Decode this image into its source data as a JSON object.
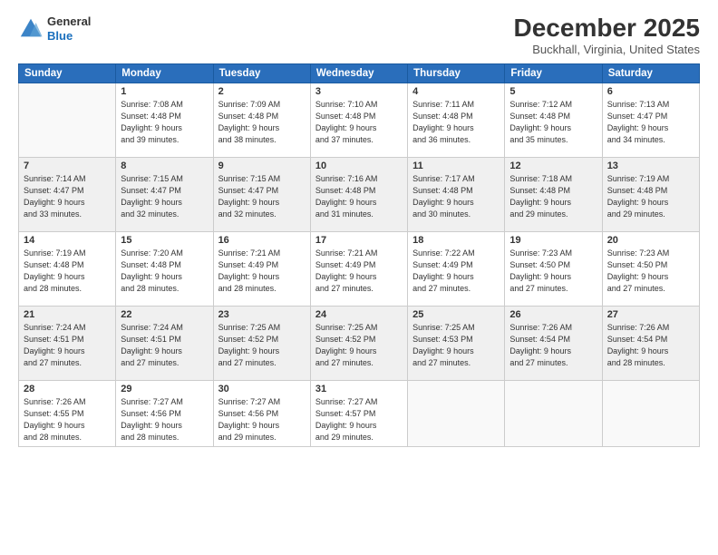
{
  "header": {
    "logo": {
      "general": "General",
      "blue": "Blue"
    },
    "title": "December 2025",
    "location": "Buckhall, Virginia, United States"
  },
  "calendar": {
    "days_of_week": [
      "Sunday",
      "Monday",
      "Tuesday",
      "Wednesday",
      "Thursday",
      "Friday",
      "Saturday"
    ],
    "weeks": [
      {
        "shaded": false,
        "days": [
          {
            "num": "",
            "info": ""
          },
          {
            "num": "1",
            "info": "Sunrise: 7:08 AM\nSunset: 4:48 PM\nDaylight: 9 hours\nand 39 minutes."
          },
          {
            "num": "2",
            "info": "Sunrise: 7:09 AM\nSunset: 4:48 PM\nDaylight: 9 hours\nand 38 minutes."
          },
          {
            "num": "3",
            "info": "Sunrise: 7:10 AM\nSunset: 4:48 PM\nDaylight: 9 hours\nand 37 minutes."
          },
          {
            "num": "4",
            "info": "Sunrise: 7:11 AM\nSunset: 4:48 PM\nDaylight: 9 hours\nand 36 minutes."
          },
          {
            "num": "5",
            "info": "Sunrise: 7:12 AM\nSunset: 4:48 PM\nDaylight: 9 hours\nand 35 minutes."
          },
          {
            "num": "6",
            "info": "Sunrise: 7:13 AM\nSunset: 4:47 PM\nDaylight: 9 hours\nand 34 minutes."
          }
        ]
      },
      {
        "shaded": true,
        "days": [
          {
            "num": "7",
            "info": "Sunrise: 7:14 AM\nSunset: 4:47 PM\nDaylight: 9 hours\nand 33 minutes."
          },
          {
            "num": "8",
            "info": "Sunrise: 7:15 AM\nSunset: 4:47 PM\nDaylight: 9 hours\nand 32 minutes."
          },
          {
            "num": "9",
            "info": "Sunrise: 7:15 AM\nSunset: 4:47 PM\nDaylight: 9 hours\nand 32 minutes."
          },
          {
            "num": "10",
            "info": "Sunrise: 7:16 AM\nSunset: 4:48 PM\nDaylight: 9 hours\nand 31 minutes."
          },
          {
            "num": "11",
            "info": "Sunrise: 7:17 AM\nSunset: 4:48 PM\nDaylight: 9 hours\nand 30 minutes."
          },
          {
            "num": "12",
            "info": "Sunrise: 7:18 AM\nSunset: 4:48 PM\nDaylight: 9 hours\nand 29 minutes."
          },
          {
            "num": "13",
            "info": "Sunrise: 7:19 AM\nSunset: 4:48 PM\nDaylight: 9 hours\nand 29 minutes."
          }
        ]
      },
      {
        "shaded": false,
        "days": [
          {
            "num": "14",
            "info": "Sunrise: 7:19 AM\nSunset: 4:48 PM\nDaylight: 9 hours\nand 28 minutes."
          },
          {
            "num": "15",
            "info": "Sunrise: 7:20 AM\nSunset: 4:48 PM\nDaylight: 9 hours\nand 28 minutes."
          },
          {
            "num": "16",
            "info": "Sunrise: 7:21 AM\nSunset: 4:49 PM\nDaylight: 9 hours\nand 28 minutes."
          },
          {
            "num": "17",
            "info": "Sunrise: 7:21 AM\nSunset: 4:49 PM\nDaylight: 9 hours\nand 27 minutes."
          },
          {
            "num": "18",
            "info": "Sunrise: 7:22 AM\nSunset: 4:49 PM\nDaylight: 9 hours\nand 27 minutes."
          },
          {
            "num": "19",
            "info": "Sunrise: 7:23 AM\nSunset: 4:50 PM\nDaylight: 9 hours\nand 27 minutes."
          },
          {
            "num": "20",
            "info": "Sunrise: 7:23 AM\nSunset: 4:50 PM\nDaylight: 9 hours\nand 27 minutes."
          }
        ]
      },
      {
        "shaded": true,
        "days": [
          {
            "num": "21",
            "info": "Sunrise: 7:24 AM\nSunset: 4:51 PM\nDaylight: 9 hours\nand 27 minutes."
          },
          {
            "num": "22",
            "info": "Sunrise: 7:24 AM\nSunset: 4:51 PM\nDaylight: 9 hours\nand 27 minutes."
          },
          {
            "num": "23",
            "info": "Sunrise: 7:25 AM\nSunset: 4:52 PM\nDaylight: 9 hours\nand 27 minutes."
          },
          {
            "num": "24",
            "info": "Sunrise: 7:25 AM\nSunset: 4:52 PM\nDaylight: 9 hours\nand 27 minutes."
          },
          {
            "num": "25",
            "info": "Sunrise: 7:25 AM\nSunset: 4:53 PM\nDaylight: 9 hours\nand 27 minutes."
          },
          {
            "num": "26",
            "info": "Sunrise: 7:26 AM\nSunset: 4:54 PM\nDaylight: 9 hours\nand 27 minutes."
          },
          {
            "num": "27",
            "info": "Sunrise: 7:26 AM\nSunset: 4:54 PM\nDaylight: 9 hours\nand 28 minutes."
          }
        ]
      },
      {
        "shaded": false,
        "days": [
          {
            "num": "28",
            "info": "Sunrise: 7:26 AM\nSunset: 4:55 PM\nDaylight: 9 hours\nand 28 minutes."
          },
          {
            "num": "29",
            "info": "Sunrise: 7:27 AM\nSunset: 4:56 PM\nDaylight: 9 hours\nand 28 minutes."
          },
          {
            "num": "30",
            "info": "Sunrise: 7:27 AM\nSunset: 4:56 PM\nDaylight: 9 hours\nand 29 minutes."
          },
          {
            "num": "31",
            "info": "Sunrise: 7:27 AM\nSunset: 4:57 PM\nDaylight: 9 hours\nand 29 minutes."
          },
          {
            "num": "",
            "info": ""
          },
          {
            "num": "",
            "info": ""
          },
          {
            "num": "",
            "info": ""
          }
        ]
      }
    ]
  }
}
